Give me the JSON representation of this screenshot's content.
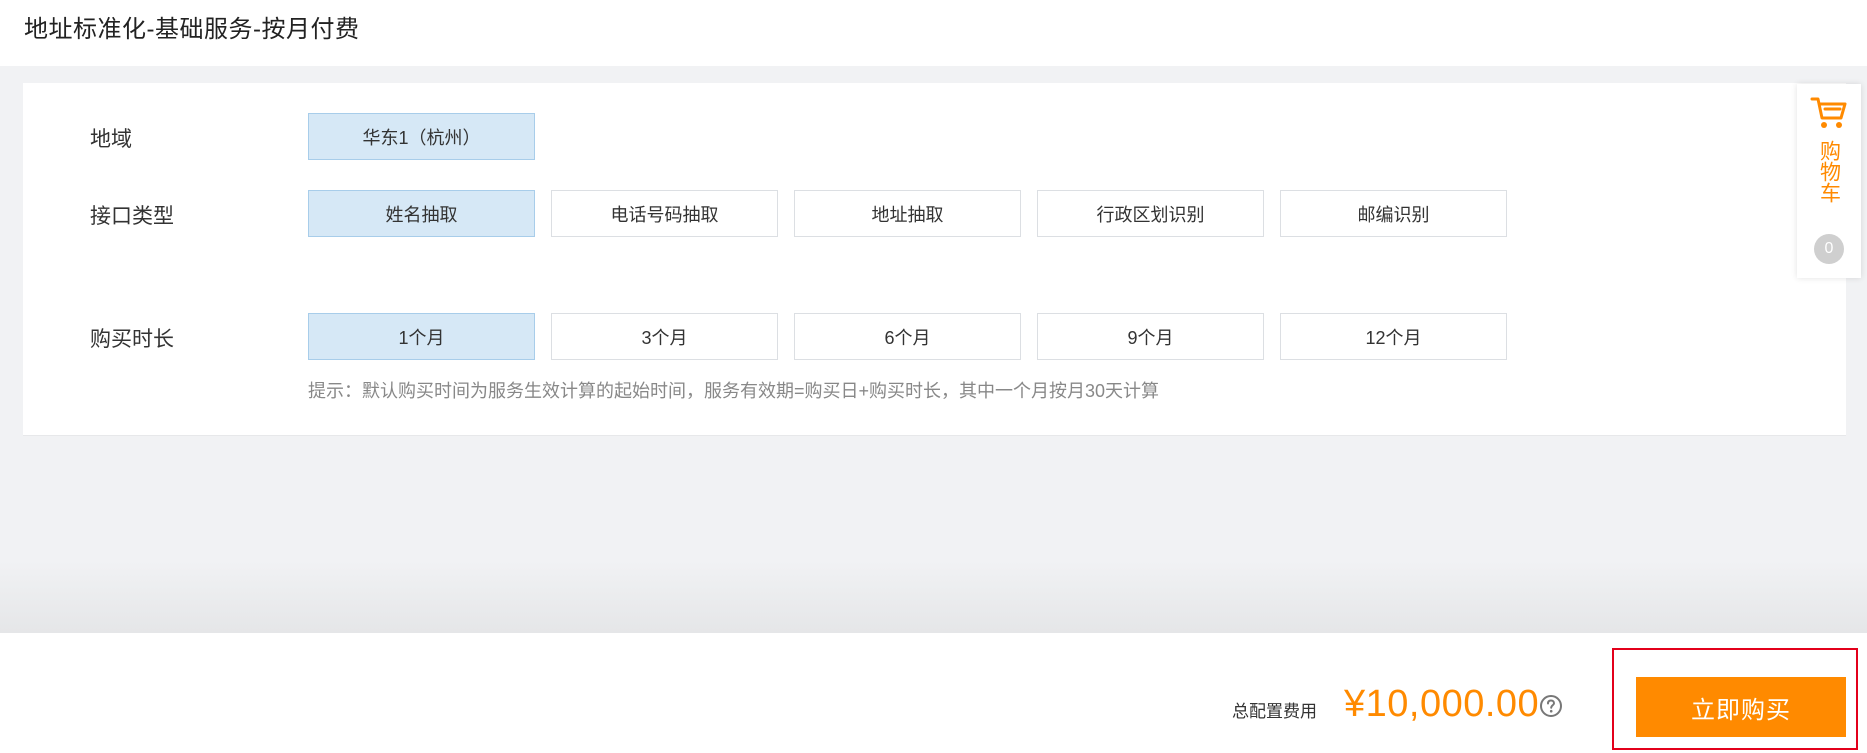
{
  "header": {
    "title": "地址标准化-基础服务-按月付费"
  },
  "region": {
    "label": "地域",
    "options": [
      "华东1（杭州）"
    ],
    "selected_index": 0
  },
  "api_type": {
    "label": "接口类型",
    "options": [
      "姓名抽取",
      "电话号码抽取",
      "地址抽取",
      "行政区划识别",
      "邮编识别"
    ],
    "selected_index": 0
  },
  "duration": {
    "label": "购买时长",
    "options": [
      "1个月",
      "3个月",
      "6个月",
      "9个月",
      "12个月"
    ],
    "selected_index": 0,
    "tip": "提示：默认购买时间为服务生效计算的起始时间，服务有效期=购买日+购买时长，其中一个月按月30天计算"
  },
  "cart": {
    "label": "购物车",
    "count": "0",
    "icon": "shopping-cart-icon"
  },
  "footer": {
    "total_label": "总配置费用",
    "total_price": "¥10,000.00",
    "help_icon": "question-circle-icon",
    "buy_label": "立即购买"
  },
  "colors": {
    "accent": "#ff8a00",
    "selected_bg": "#d6e8f6",
    "selected_border": "#a8cdea",
    "highlight_border": "#e3001b"
  }
}
